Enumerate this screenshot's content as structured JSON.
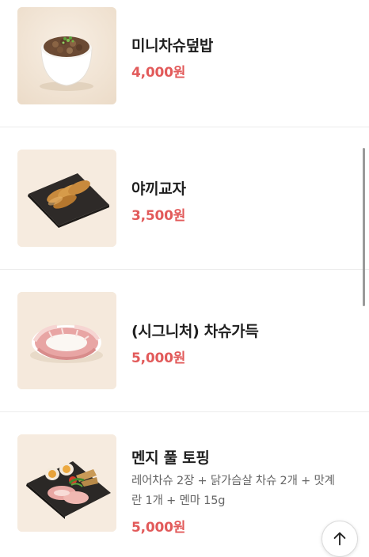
{
  "menu_items": [
    {
      "name": "미니차슈덮밥",
      "price": "4,000원",
      "image": "mini-chashu-rice-bowl-photo"
    },
    {
      "name": "야끼교자",
      "price": "3,500원",
      "image": "yaki-gyoza-photo"
    },
    {
      "name": "(시그니처) 차슈가득",
      "price": "5,000원",
      "image": "signature-chashu-photo"
    },
    {
      "name": "멘지 풀 토핑",
      "description_line1": "레어차슈 2장 + 닭가슴살 차슈 2개 + 맛계",
      "description_line2": "란 1개 + 멘마 15g",
      "price": "5,000원",
      "image": "menji-full-topping-photo"
    }
  ],
  "colors": {
    "price": "#e25a5a",
    "name": "#1f1f1f",
    "description": "#666666",
    "divider": "#ececec"
  },
  "icons": {
    "scroll_top": "arrow-up-icon"
  }
}
